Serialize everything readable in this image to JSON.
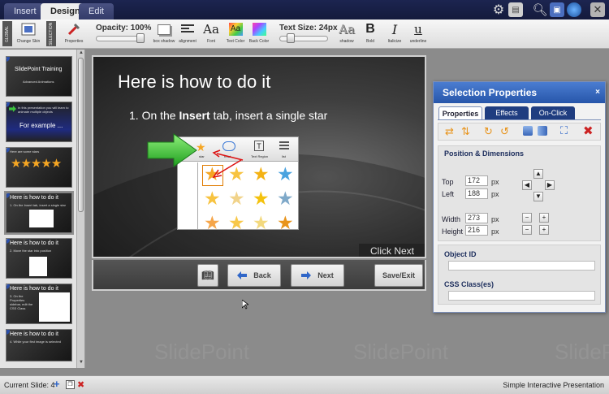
{
  "topbar": {
    "tabs": [
      {
        "label": "Insert"
      },
      {
        "label": "Design"
      },
      {
        "label": "Edit"
      }
    ]
  },
  "ribbon": {
    "global_label": "GLOBAL",
    "selection_label": "SELECTION",
    "change_skin": "Change Skin",
    "properties": "Properties",
    "opacity_label": "Opacity: 100%",
    "opacity_value": 100,
    "box_shadow": "box shadow",
    "alignment": "alignment",
    "font_glyph": "Aa",
    "font": "Font",
    "text_color": "Text Color",
    "back_color": "Back Color",
    "text_size_label": "Text Size: 24px",
    "shadow_glyph": "Aa",
    "shadow": "shadow",
    "bold": "Bold",
    "italicize": "Italicize",
    "underline": "underline"
  },
  "thumbnails": [
    {
      "num": "1",
      "title": "SlidePoint Training",
      "sub": "Advanced Animations"
    },
    {
      "num": "2",
      "title": "For example ...",
      "sub": "In this presentation you will learn to animate multiple objects"
    },
    {
      "num": "3",
      "title": "",
      "sub": "Here are some stars"
    },
    {
      "num": "4",
      "title": "Here is how to do it",
      "sub": "1. On the Insert tab, insert a single star"
    },
    {
      "num": "5",
      "title": "Here is how to do it",
      "sub": "2. Move the star into position"
    },
    {
      "num": "6",
      "title": "Here is how to do it",
      "sub": "3. On the Properties sidebar, edit the CSS Class"
    },
    {
      "num": "7",
      "title": "Here is how to do it",
      "sub": "4. While your first image is selected"
    }
  ],
  "slide": {
    "title": "Here is how to do it",
    "bullet_prefix": "1. On the ",
    "bullet_bold": "Insert",
    "bullet_suffix": " tab, insert a single star",
    "click_next": "Click Next",
    "screenshot": {
      "star_label": "star",
      "rrect_label": "rrect",
      "text_label": "Text Region",
      "list_label": "list",
      "text_glyph": "T"
    }
  },
  "nav": {
    "back": "Back",
    "next": "Next",
    "save_exit": "Save/Exit"
  },
  "panel": {
    "title": "Selection Properties",
    "close": "×",
    "tabs": [
      {
        "label": "Properties"
      },
      {
        "label": "Effects"
      },
      {
        "label": "On-Click"
      }
    ],
    "section_position": "Position & Dimensions",
    "top_label": "Top",
    "top_value": "172",
    "left_label": "Left",
    "left_value": "188",
    "width_label": "Width",
    "width_value": "273",
    "height_label": "Height",
    "height_value": "216",
    "unit": "px",
    "object_id_label": "Object ID",
    "object_id_value": "",
    "css_class_label": "CSS Class(es)",
    "css_class_value": ""
  },
  "status": {
    "current_slide_label": "Current Slide: 4",
    "app_name": "Simple Interactive Presentation"
  },
  "watermark": "SlidePoint",
  "colors": {
    "topbar": "#1c2550",
    "panel_header": "#2756aa",
    "tab_dark": "#1f3d80",
    "star_orange": "#f5a623",
    "arrow_green": "#3cc23c",
    "delete_red": "#cc2222"
  }
}
